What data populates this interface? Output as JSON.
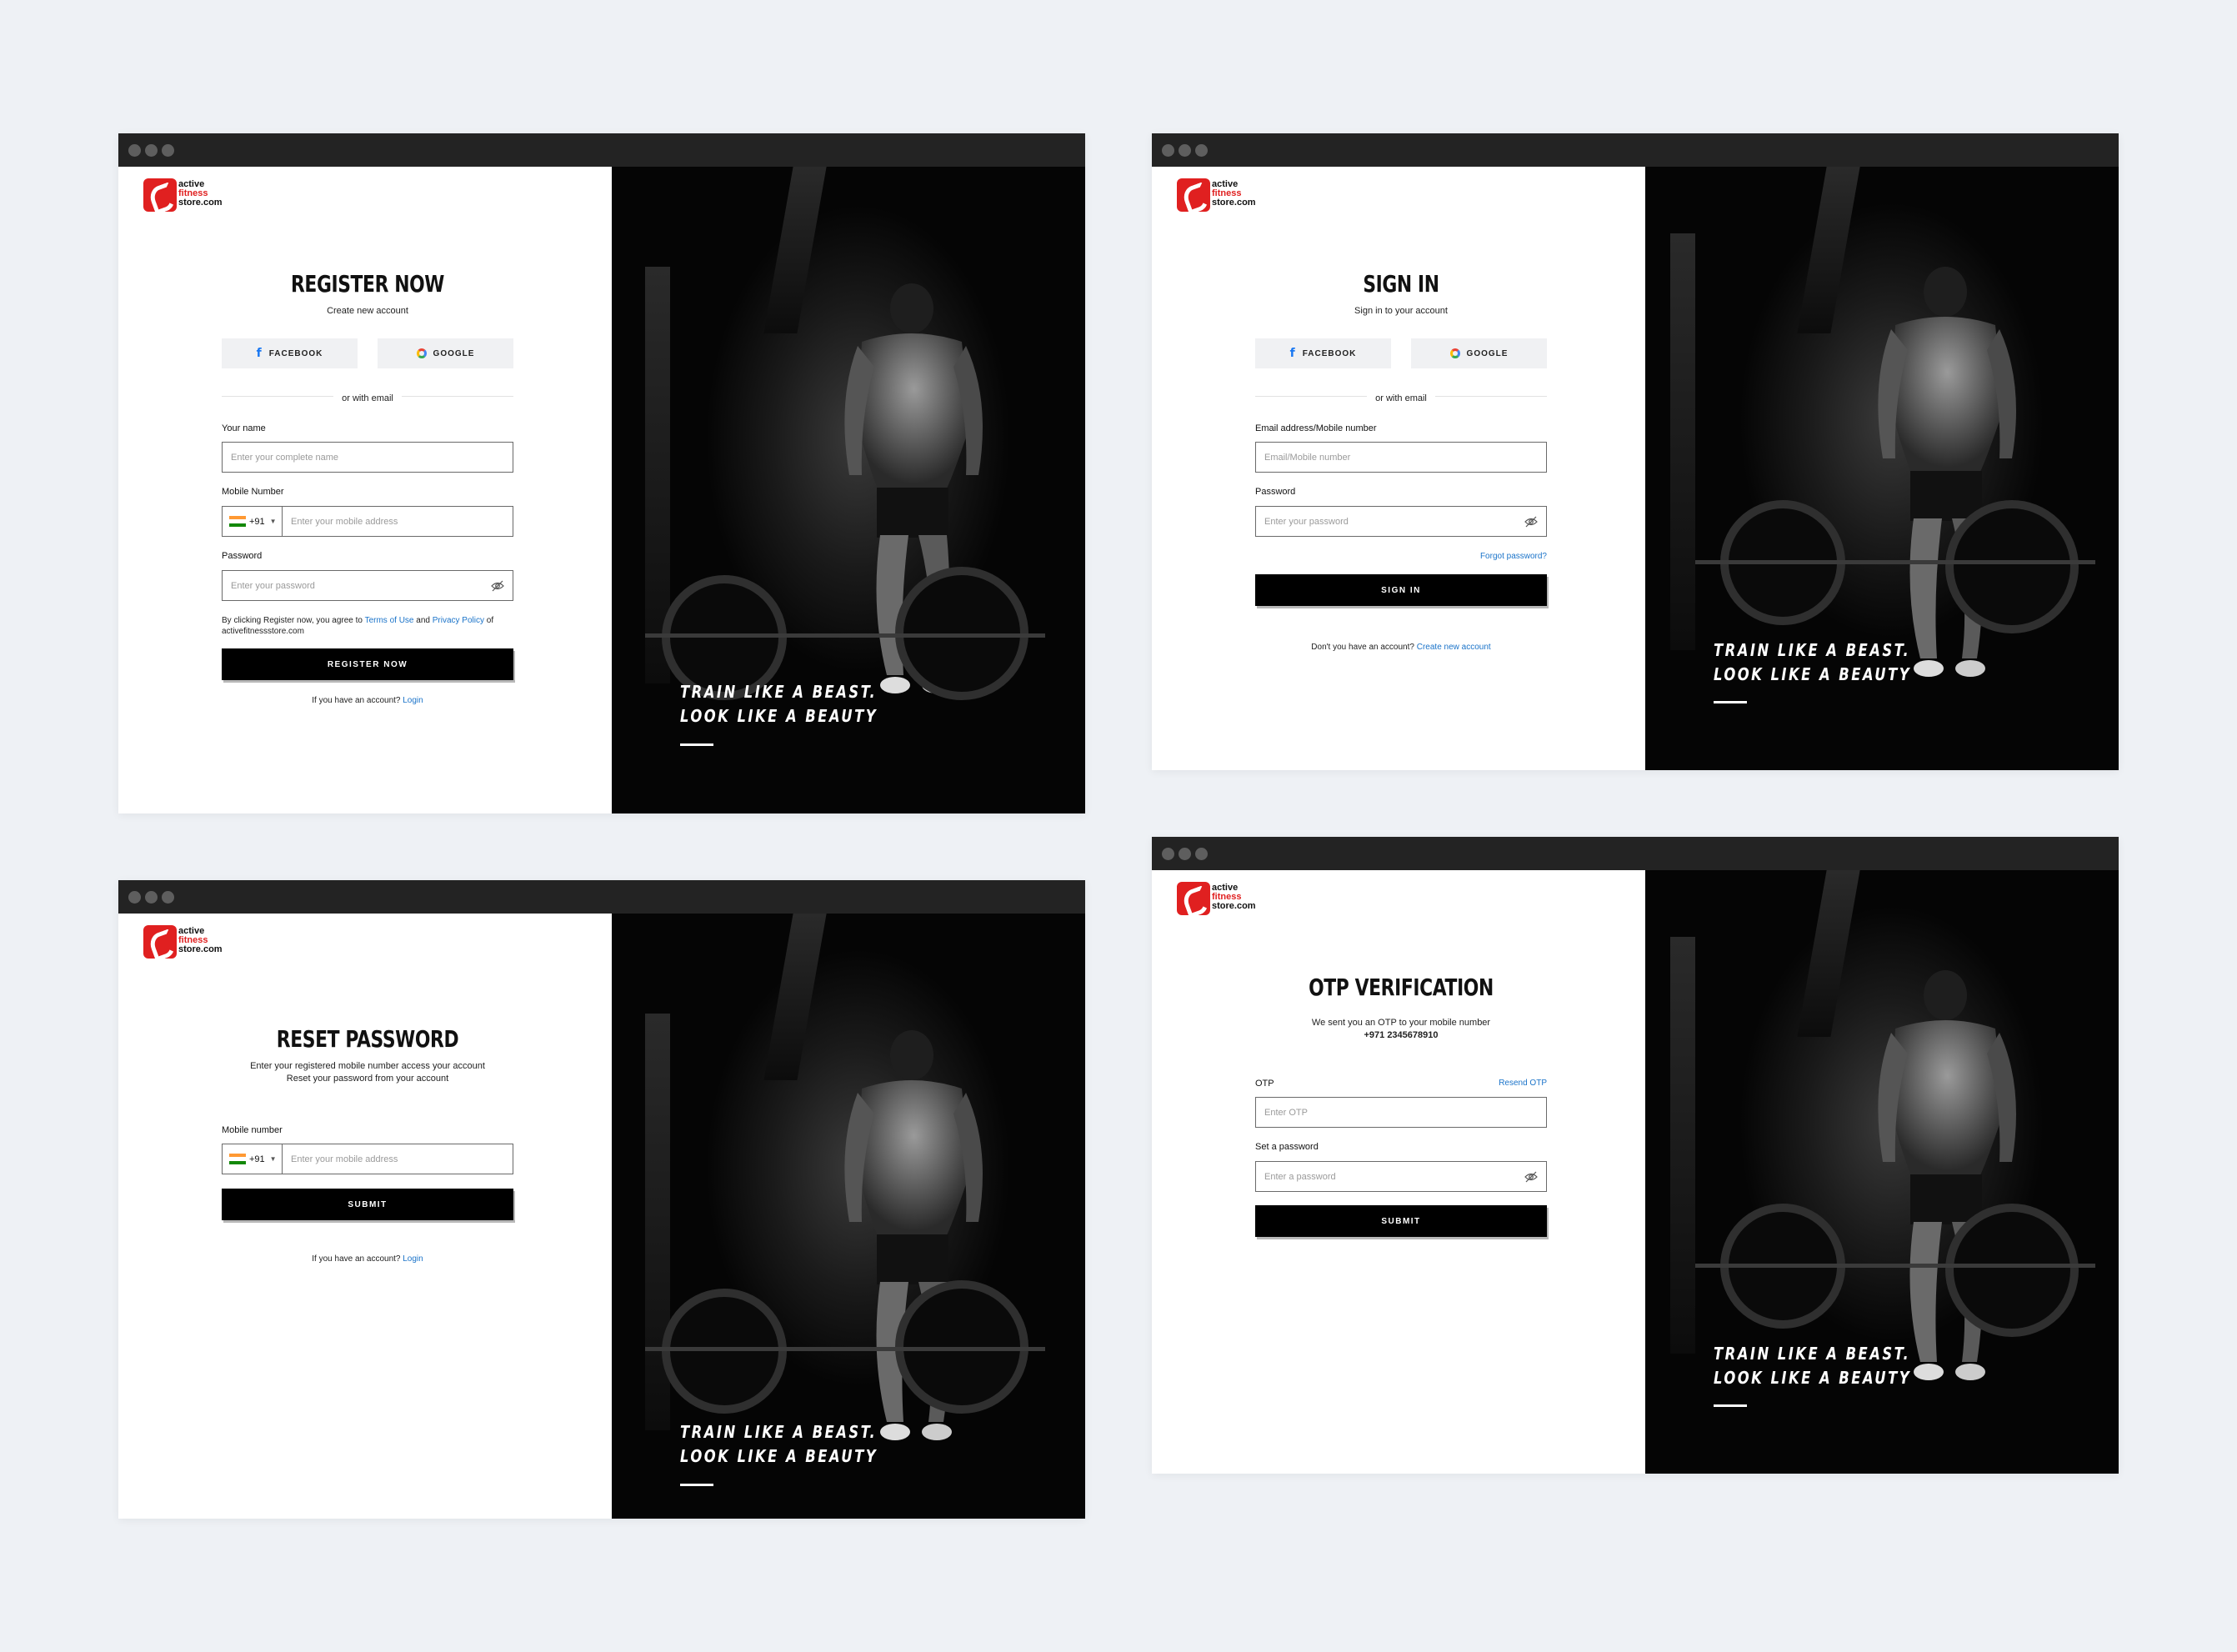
{
  "brand": {
    "logo_line1": "active",
    "logo_line2": "fitness",
    "logo_line3": "store.com"
  },
  "hero": {
    "tagline_line1": "TRAIN LIKE A BEAST.",
    "tagline_line2": "LOOK LIKE A BEAUTY"
  },
  "register": {
    "title": "REGISTER NOW",
    "subtitle": "Create new account",
    "facebook_label": "FACEBOOK",
    "google_label": "GOOGLE",
    "divider_text": "or with email",
    "name_label": "Your name",
    "name_placeholder": "Enter your complete name",
    "mobile_label": "Mobile Number",
    "country_code": "+91",
    "mobile_placeholder": "Enter your mobile address",
    "password_label": "Password",
    "password_placeholder": "Enter your password",
    "terms_prefix": "By clicking Register now, you agree to ",
    "terms_link": "Terms of Use",
    "terms_and": " and ",
    "privacy_link": "Privacy Policy",
    "terms_suffix": " of",
    "terms_domain": "activefitnessstore.com",
    "submit_label": "REGISTER NOW",
    "account_prompt": "If you have an account? ",
    "login_link": "Login"
  },
  "signin": {
    "title": "SIGN IN",
    "subtitle": "Sign in to your account",
    "facebook_label": "FACEBOOK",
    "google_label": "GOOGLE",
    "divider_text": "or with email",
    "email_label": "Email address/Mobile number",
    "email_placeholder": "Email/Mobile number",
    "password_label": "Password",
    "password_placeholder": "Enter your password",
    "forgot_link": "Forgot password?",
    "submit_label": "SIGN IN",
    "no_account_prompt": "Don't you have an account? ",
    "create_link": "Create new account"
  },
  "reset": {
    "title": "RESET PASSWORD",
    "subtitle_line1": "Enter your registered mobile number access your account",
    "subtitle_line2": "Reset your password from your account",
    "mobile_label": "Mobile number",
    "country_code": "+91",
    "mobile_placeholder": "Enter your mobile address",
    "submit_label": "SUBMIT",
    "account_prompt": "If you have an account? ",
    "login_link": "Login"
  },
  "otp": {
    "title": "OTP VERIFICATION",
    "subtitle_line1": "We sent you an OTP to your mobile number",
    "phone_number": "+971 2345678910",
    "otp_label": "OTP",
    "resend_link": "Resend OTP",
    "otp_placeholder": "Enter OTP",
    "password_label": "Set a password",
    "password_placeholder": "Enter a password",
    "submit_label": "SUBMIT"
  },
  "colors": {
    "background": "#eef1f5",
    "titlebar": "#232323",
    "brand_red": "#e02020",
    "link_blue": "#1a73c9",
    "button_black": "#000000"
  }
}
